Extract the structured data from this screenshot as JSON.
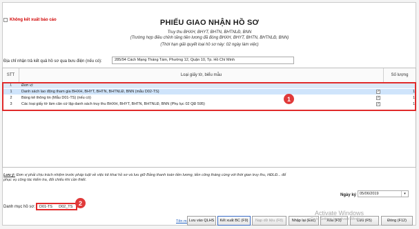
{
  "options": {
    "no_export_label": "Không kết xuất báo cáo"
  },
  "header": {
    "title": "PHIẾU GIAO NHẬN HỒ SƠ",
    "line1": "Truy thu BHXH, BHYT, BHTN, BHTNLĐ, BNN",
    "line2": "(Trường hợp điều chỉnh tăng tiền lương đã đóng BHXH, BHYT, BHTN, BHTNLĐ, BNN)",
    "line3": "(Thời hạn giải quyết loại hồ sơ này: 02 ngày làm việc)"
  },
  "address": {
    "label": "Địa chỉ nhận trả kết quả hồ sơ qua bưu điện (nếu có):",
    "value": "285/94 Cách Mạng Tháng Tám, Phường 12, Quận 10, Tp. Hồ Chí Minh"
  },
  "table": {
    "headers": {
      "stt": "STT",
      "name": "Loại giấy tờ, biểu mẫu",
      "qty": "Số lượng"
    },
    "group_row": {
      "stt": "I.",
      "name": "Đơn vị:"
    },
    "rows": [
      {
        "stt": "1",
        "name": "Danh sách lao động tham gia BHXH, BHYT, BHTN, BHTNLĐ, BNN (mẫu D02-TS)",
        "checked": "✓",
        "qty": "1"
      },
      {
        "stt": "2",
        "name": "Bảng kê thông tin (Mẫu D01-TS) (nếu có)",
        "checked": "✓",
        "qty": "1"
      },
      {
        "stt": "3",
        "name": "Các loại giấy tờ làm căn cứ lập danh sách truy thu BHXH, BHYT, BHTN, BHTNLĐ, BNN (Phụ lục 02 QĐ 595)",
        "checked": "✓",
        "qty": "1"
      }
    ]
  },
  "markers": {
    "one": "1",
    "two": "2"
  },
  "note": {
    "label": "Lưu ý:",
    "text": " Đơn vị phải chịu trách nhiệm trước pháp luật về việc kê khai hồ sơ và lưu giữ Bảng thanh toán tiền lương, tiền công tháng cùng với thời gian truy thu, HĐLĐ... để phục vụ công tác kiểm tra, đối chiếu khi cần thiết."
  },
  "date": {
    "label": "Ngày ký",
    "value": "05/06/2019",
    "dropdown": "▾"
  },
  "catalog": {
    "label": "Danh mục hồ sơ:",
    "items": "D01-TS      D02_TS"
  },
  "footer": {
    "link": "Tên mẫu",
    "buttons": {
      "save_qlhs": "Lưu vào QLHS",
      "export": "Kết xuất BC (F9)",
      "load_file": "Nạp dữ liệu (F8)",
      "reload": "Nhập lại (Esc)",
      "delete": "Xóa (F3)",
      "save": "Lưu (F5)",
      "close": "Đóng (F12)"
    }
  },
  "watermark": {
    "title": "Activate Windows",
    "sub": "Go to Settings to activate Windows."
  }
}
